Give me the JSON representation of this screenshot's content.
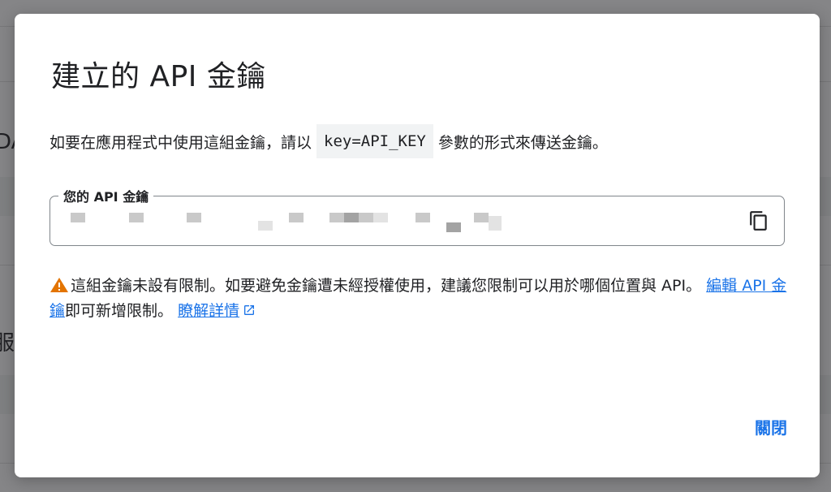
{
  "dialog": {
    "title": "建立的 API 金鑰",
    "instruction_before": "如要在應用程式中使用這組金鑰，請以",
    "instruction_code": "key=API_KEY",
    "instruction_after": "參數的形式來傳送金鑰。",
    "key_field_label": "您的 API 金鑰",
    "key_field_value_state": "redacted (pixelated)",
    "copy_icon": "copy-icon",
    "warning_icon": "warning-triangle-icon",
    "warning_icon_color": "#e37400",
    "warning_text": "這組金鑰未設有限制。如要避免金鑰遭未經授權使用，建議您限制可以用於哪個位置與 API。",
    "edit_link": "編輯 API 金鑰",
    "edit_link_suffix": "即可新增限制。",
    "learn_more_link": "瞭解詳情",
    "external_link_icon": "external-link-icon",
    "close_label": "關閉",
    "accent_color": "#1a73e8"
  },
  "background": {
    "edge_text_top": "DA",
    "edge_text_bottom": "服"
  }
}
